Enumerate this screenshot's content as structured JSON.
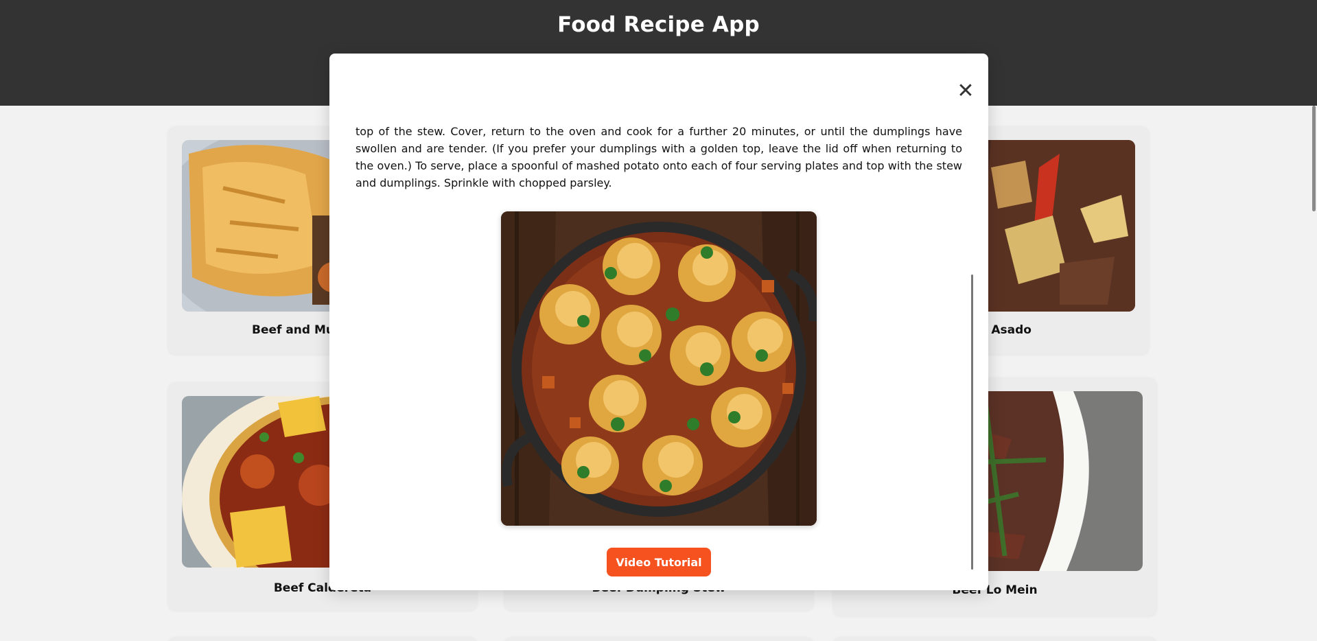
{
  "app": {
    "title": "Food Recipe App"
  },
  "recipes": [
    {
      "title": "Beef and Mustard Pie"
    },
    {
      "title": "Beef Asado"
    },
    {
      "title": "Beef Caldereta"
    },
    {
      "title": "Beef Dumpling Stew"
    },
    {
      "title": "Beef Lo Mein"
    }
  ],
  "modal": {
    "instructions": "top of the stew. Cover, return to the oven and cook for a further 20 minutes, or until the dumplings have swollen and are tender. (If you prefer your dumplings with a golden top, leave the lid off when returning to the oven.) To serve, place a spoonful of mashed potato onto each of four serving plates and top with the stew and dumplings. Sprinkle with chopped parsley.",
    "close_icon": "close-icon",
    "video_button_label": "Video Tutorial"
  },
  "colors": {
    "header_bg": "#333333",
    "accent": "#f5521f",
    "page_bg": "#f2f2f2"
  }
}
